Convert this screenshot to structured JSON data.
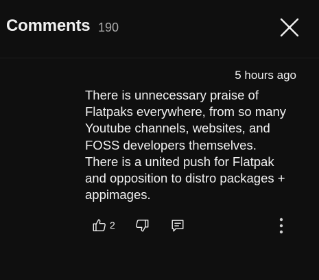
{
  "header": {
    "title": "Comments",
    "count": "190",
    "close_icon": "close-icon"
  },
  "comment": {
    "timestamp": "5 hours ago",
    "text_lines": [
      "There is unnecessary praise of",
      "Flatpaks everywhere, from so many",
      "Youtube channels, websites, and",
      "FOSS developers themselves.",
      "There is a united push for Flatpak",
      "and opposition to distro packages +",
      "appimages."
    ],
    "like_count": "2",
    "icons": {
      "like": "thumbs-up-icon",
      "dislike": "thumbs-down-icon",
      "reply": "reply-icon",
      "more": "more-vertical-icon"
    }
  },
  "colors": {
    "background": "#0f0f0f",
    "text": "#f1f1f1",
    "secondary_text": "#aaaaaa"
  }
}
